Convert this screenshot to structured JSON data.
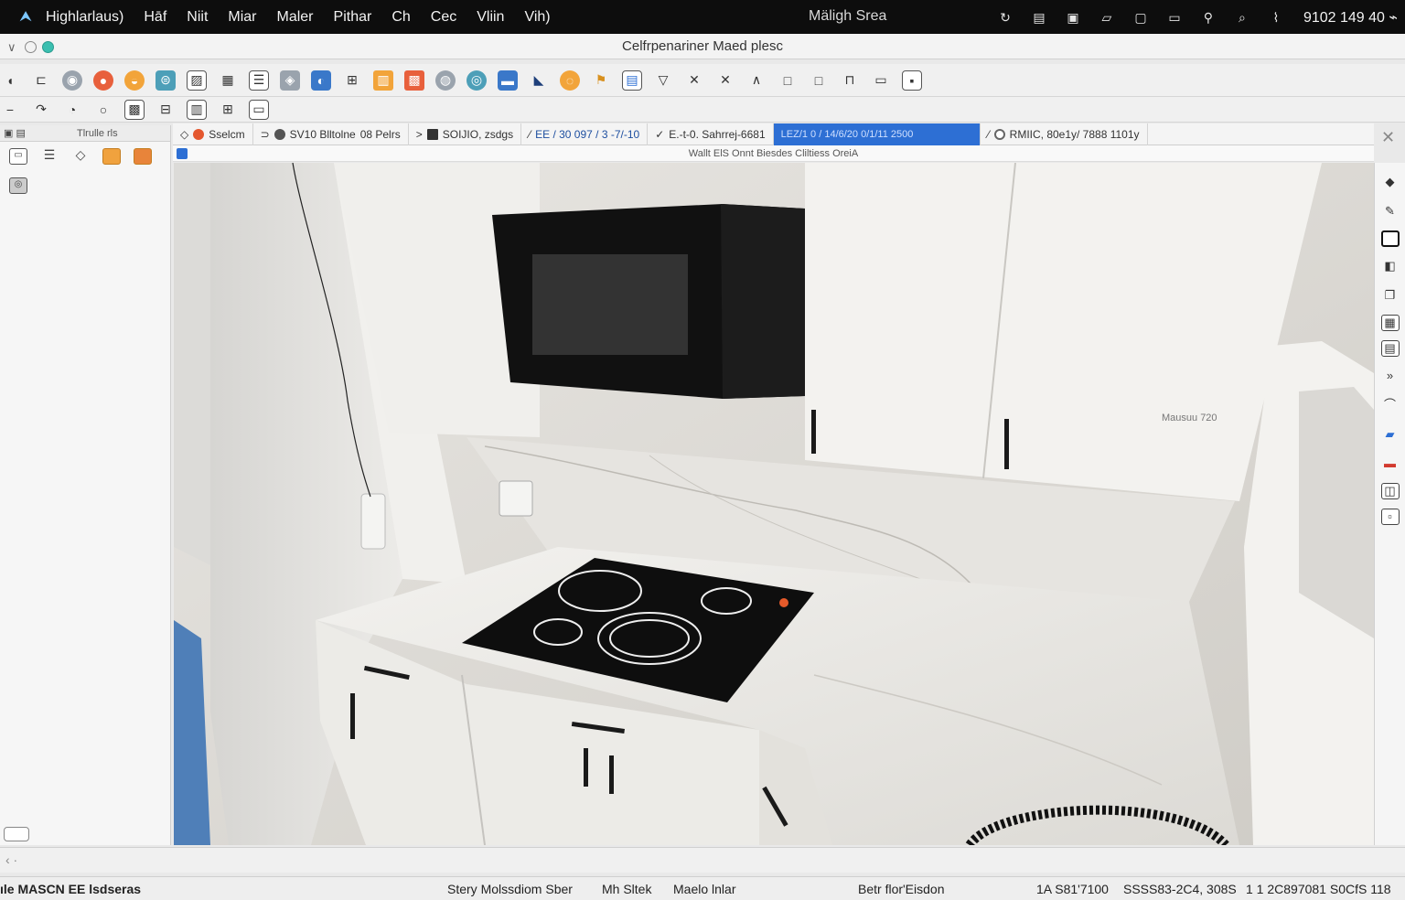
{
  "menubar": {
    "app_name": "Highlarlaus)",
    "items": [
      "Hāf",
      "Niit",
      "Miar",
      "Maler",
      "Pithar",
      "Ch",
      "Cec",
      "Vliin",
      "Vih)"
    ],
    "center_title": "Mäligh Srea",
    "clock": "9102 149 40 ⌁",
    "tray_icons": [
      "sync-icon",
      "printer-icon",
      "window-icon",
      "folder-icon",
      "square-icon",
      "display-icon",
      "location-icon",
      "search-icon",
      "wifi-icon"
    ]
  },
  "window": {
    "title": "Celfrpenariner Maed plesc"
  },
  "toolbar_primary": {
    "icons": [
      "circle-icon",
      "edit-icon",
      "palette-icon",
      "record-icon",
      "sun-icon",
      "cylinder-icon",
      "image-icon",
      "save-icon",
      "layers-icon",
      "material-icon",
      "globe-small-icon",
      "grid-icon",
      "brick-icon",
      "globe-icon",
      "sphere-icon",
      "export-icon",
      "chat-icon",
      "target-icon",
      "flag-icon",
      "chart-icon",
      "triangle-icon",
      "cross-icon",
      "cross-alt-icon",
      "angle-icon",
      "square-icon",
      "rectangle-icon",
      "path-icon",
      "frame-icon",
      "lock-icon"
    ]
  },
  "toolbar_secondary": {
    "icons": [
      "minus-icon",
      "arrow-icon",
      "spiral-icon",
      "circle-outline-icon",
      "image-icon",
      "sliders-icon",
      "book-icon",
      "grid-alt-icon",
      "picture-icon"
    ]
  },
  "left_panel": {
    "title": "Tlrulle rls",
    "icons": [
      "monitor-icon",
      "list-icon",
      "diamond-icon",
      "box-orange-icon",
      "folder-orange-icon",
      "camera-icon",
      "settings-icon"
    ]
  },
  "tabs": [
    {
      "label": "Sselcm",
      "dot": "#e4572e"
    },
    {
      "label": "SV10 Blltolne",
      "dot": "#555555"
    },
    {
      "label": "08 Pelrs",
      "dot": ""
    },
    {
      "label": "SOIJIO,  zsdgs",
      "dot": "#333333"
    },
    {
      "label": "EE / 30 097 / 3 -7/-10",
      "dot": ""
    },
    {
      "label": "E.-t-0. Sahrrej-6681",
      "dot": ""
    },
    {
      "label": "LEZ/1 0 / 14/6/20 0/1/11 2500",
      "dot": "",
      "active": true
    },
    {
      "label": "RMIIC, 80e1y/ 7888 1101y",
      "dot": "#666666"
    }
  ],
  "subheader": {
    "text": "Wallt ElS Onnt Biesdes Cliltiess OreiA"
  },
  "viewport": {
    "label": "Mausuu 720"
  },
  "right_panel": {
    "icons": [
      "diamond-icon",
      "pen-icon",
      "monitor-icon",
      "layer-icon",
      "folder-icon",
      "calculator-icon",
      "save-icon",
      "chevron-right-icon",
      "paint-icon",
      "folder-blue-icon",
      "tag-red-icon",
      "film-icon",
      "page-icon"
    ]
  },
  "statusbar": {
    "left": "ıle  MASCN EE lsdseras",
    "mid1": "Stery Molssdiom Sber",
    "mid2": "Mh Sltek",
    "mid3": "Maelo lnlar",
    "mid4": "Betr flor'Eisdon",
    "coord1": "1A S81'7100",
    "coord2": "SSSS83-2C4, 308S",
    "coord3": "1 1 2C897081  S0CfS 118"
  },
  "colors": {
    "accent": "#2d6fd4",
    "menubar_bg": "#0d0d0d"
  }
}
